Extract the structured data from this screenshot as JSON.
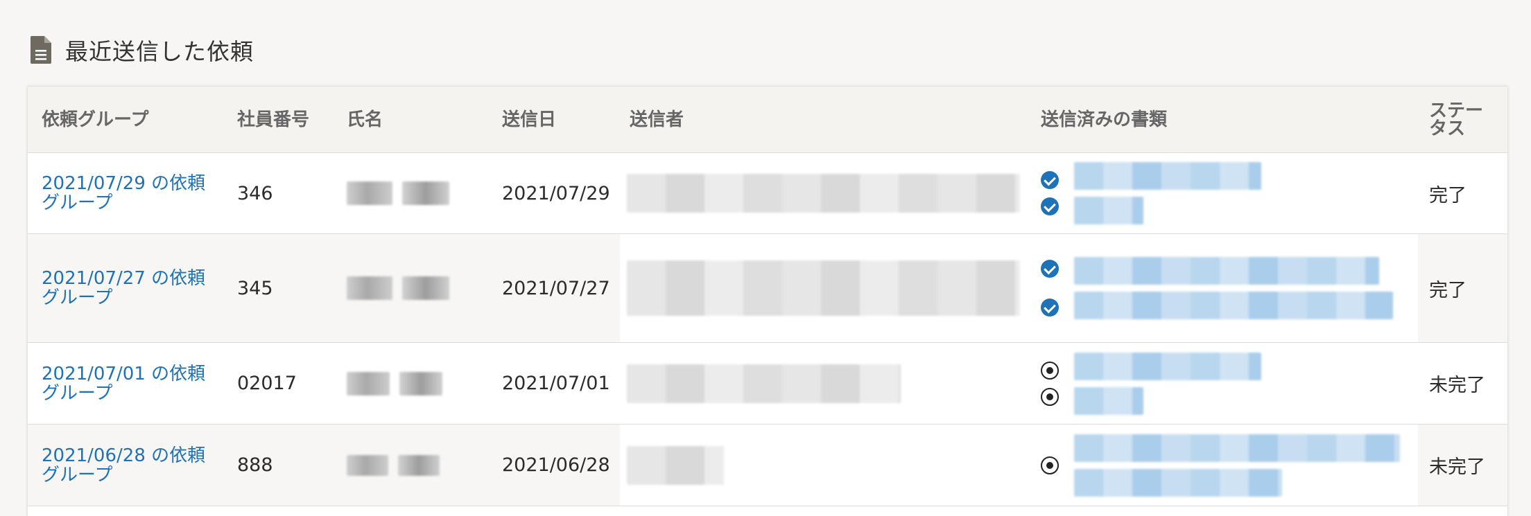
{
  "section": {
    "title": "最近送信した依頼",
    "icon": "document-icon"
  },
  "table": {
    "headers": [
      "依頼グループ",
      "社員番号",
      "氏名",
      "送信日",
      "送信者",
      "送信済みの書類",
      "ステータス"
    ],
    "rows": [
      {
        "group": "2021/07/29 の依頼グループ",
        "employee_no": "346",
        "sent_date": "2021/07/29",
        "doc_status": "complete",
        "status": "完了"
      },
      {
        "group": "2021/07/27 の依頼グループ",
        "employee_no": "345",
        "sent_date": "2021/07/27",
        "doc_status": "complete",
        "status": "完了"
      },
      {
        "group": "2021/07/01 の依頼グループ",
        "employee_no": "02017",
        "sent_date": "2021/07/01",
        "doc_status": "pending",
        "status": "未完了"
      },
      {
        "group": "2021/06/28 の依頼グループ",
        "employee_no": "888",
        "sent_date": "2021/06/28",
        "doc_status": "pending",
        "status": "未完了"
      }
    ]
  },
  "colors": {
    "link": "#1e72b8",
    "header_bg": "#f5f3f0",
    "page_bg": "#f7f6f4"
  }
}
